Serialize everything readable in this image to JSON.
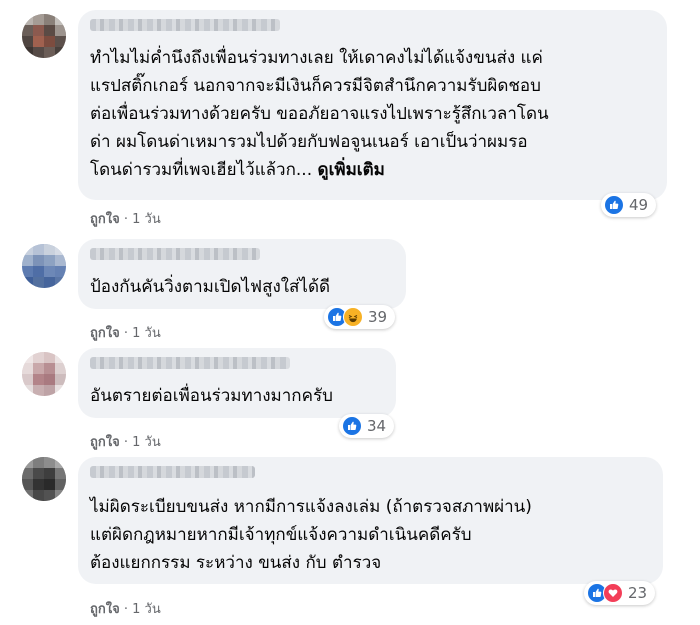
{
  "colors": {
    "bubble": "#f0f2f5",
    "meta": "#65676b",
    "like": "#1b74e4",
    "haha": "#f7b125",
    "love": "#f33e58"
  },
  "comments": [
    {
      "text": "ทำไมไม่ค่ำนึงถึงเพื่อนร่วมทางเลย ให้เดาคงไม่ได้แจ้งขนส่ง แค่\nแรปสติ๊กเกอร์ นอกจากจะมีเงินก็ควรมีจิตสำนึกความรับผิดชอบ\nต่อเพื่อนร่วมทางด้วยครับ ขออภัยอาจแรงไปเพราะรู้สึกเวลาโดน\nด่า ผมโดนด่าเหมารวมไปด้วยกับฟอจูนเนอร์ เอาเป็นว่าผมรอ\nโดนด่ารวมที่เพจเฮียไว้แล้วก... ",
      "see_more": "ดูเพิ่มเติม",
      "like_label": "ถูกใจ",
      "time": "1 วัน",
      "reactions": [
        "like-icon"
      ],
      "reaction_count": "49"
    },
    {
      "text": "ป้องกันคันวิ่งตามเปิดไฟสูงใส่ได้ดี",
      "like_label": "ถูกใจ",
      "time": "1 วัน",
      "reactions": [
        "like-icon",
        "haha-icon"
      ],
      "reaction_count": "39"
    },
    {
      "text": "อันตรายต่อเพื่อนร่วมทางมากครับ",
      "like_label": "ถูกใจ",
      "time": "1 วัน",
      "reactions": [
        "like-icon"
      ],
      "reaction_count": "34"
    },
    {
      "text": "ไม่ผิดระเบียบขนส่ง หากมีการแจ้งลงเล่ม (ถ้าตรวจสภาพผ่าน)\nแต่ผิดกฎหมายหากมีเจ้าทุกข์แจ้งความดำเนินคดีครับ\nต้องแยกกรรม ระหว่าง ขนส่ง กับ ตำรวจ",
      "like_label": "ถูกใจ",
      "time": "1 วัน",
      "reactions": [
        "like-icon",
        "love-icon"
      ],
      "reaction_count": "23"
    }
  ]
}
